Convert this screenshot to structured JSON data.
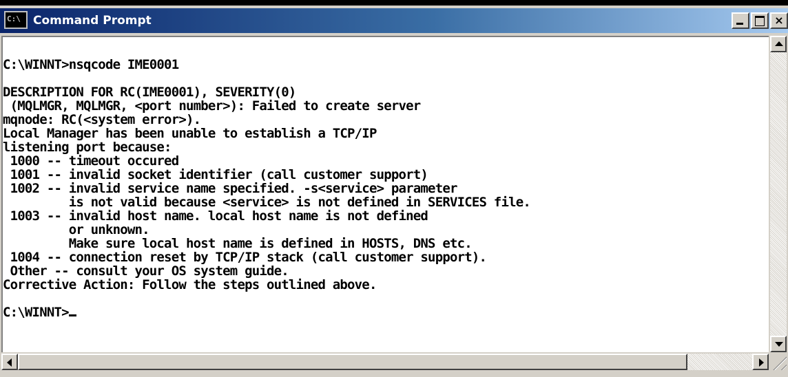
{
  "window": {
    "title": "Command Prompt",
    "icon": "cmd-icon",
    "icon_glyph": "C:\\",
    "buttons": {
      "minimize": "minimize-icon",
      "maximize": "maximize-icon",
      "close": "close-icon",
      "close_glyph": "×"
    }
  },
  "console": {
    "lines": [
      "C:\\WINNT>nsqcode IME0001",
      "",
      "DESCRIPTION FOR RC(IME0001), SEVERITY(0)",
      " (MQLMGR, MQLMGR, <port number>): Failed to create server",
      "mqnode: RC(<system error>).",
      "Local Manager has been unable to establish a TCP/IP",
      "listening port because:",
      " 1000 -- timeout occured",
      " 1001 -- invalid socket identifier (call customer support)",
      " 1002 -- invalid service name specified. -s<service> parameter",
      "         is not valid because <service> is not defined in SERVICES file.",
      " 1003 -- invalid host name. local host name is not defined",
      "         or unknown.",
      "         Make sure local host name is defined in HOSTS, DNS etc.",
      " 1004 -- connection reset by TCP/IP stack (call customer support).",
      " Other -- consult your OS system guide.",
      "Corrective Action: Follow the steps outlined above.",
      "",
      "C:\\WINNT>"
    ],
    "text_color": "#000000",
    "background": "#ffffff"
  },
  "scrollbars": {
    "vertical": {
      "up": "scroll-up-arrow-icon",
      "down": "scroll-down-arrow-icon"
    },
    "horizontal": {
      "left": "scroll-left-arrow-icon",
      "right": "scroll-right-arrow-icon"
    }
  },
  "colors": {
    "titlebar_start": "#0a246a",
    "titlebar_end": "#a6caf0",
    "chrome": "#d4d0c8"
  }
}
